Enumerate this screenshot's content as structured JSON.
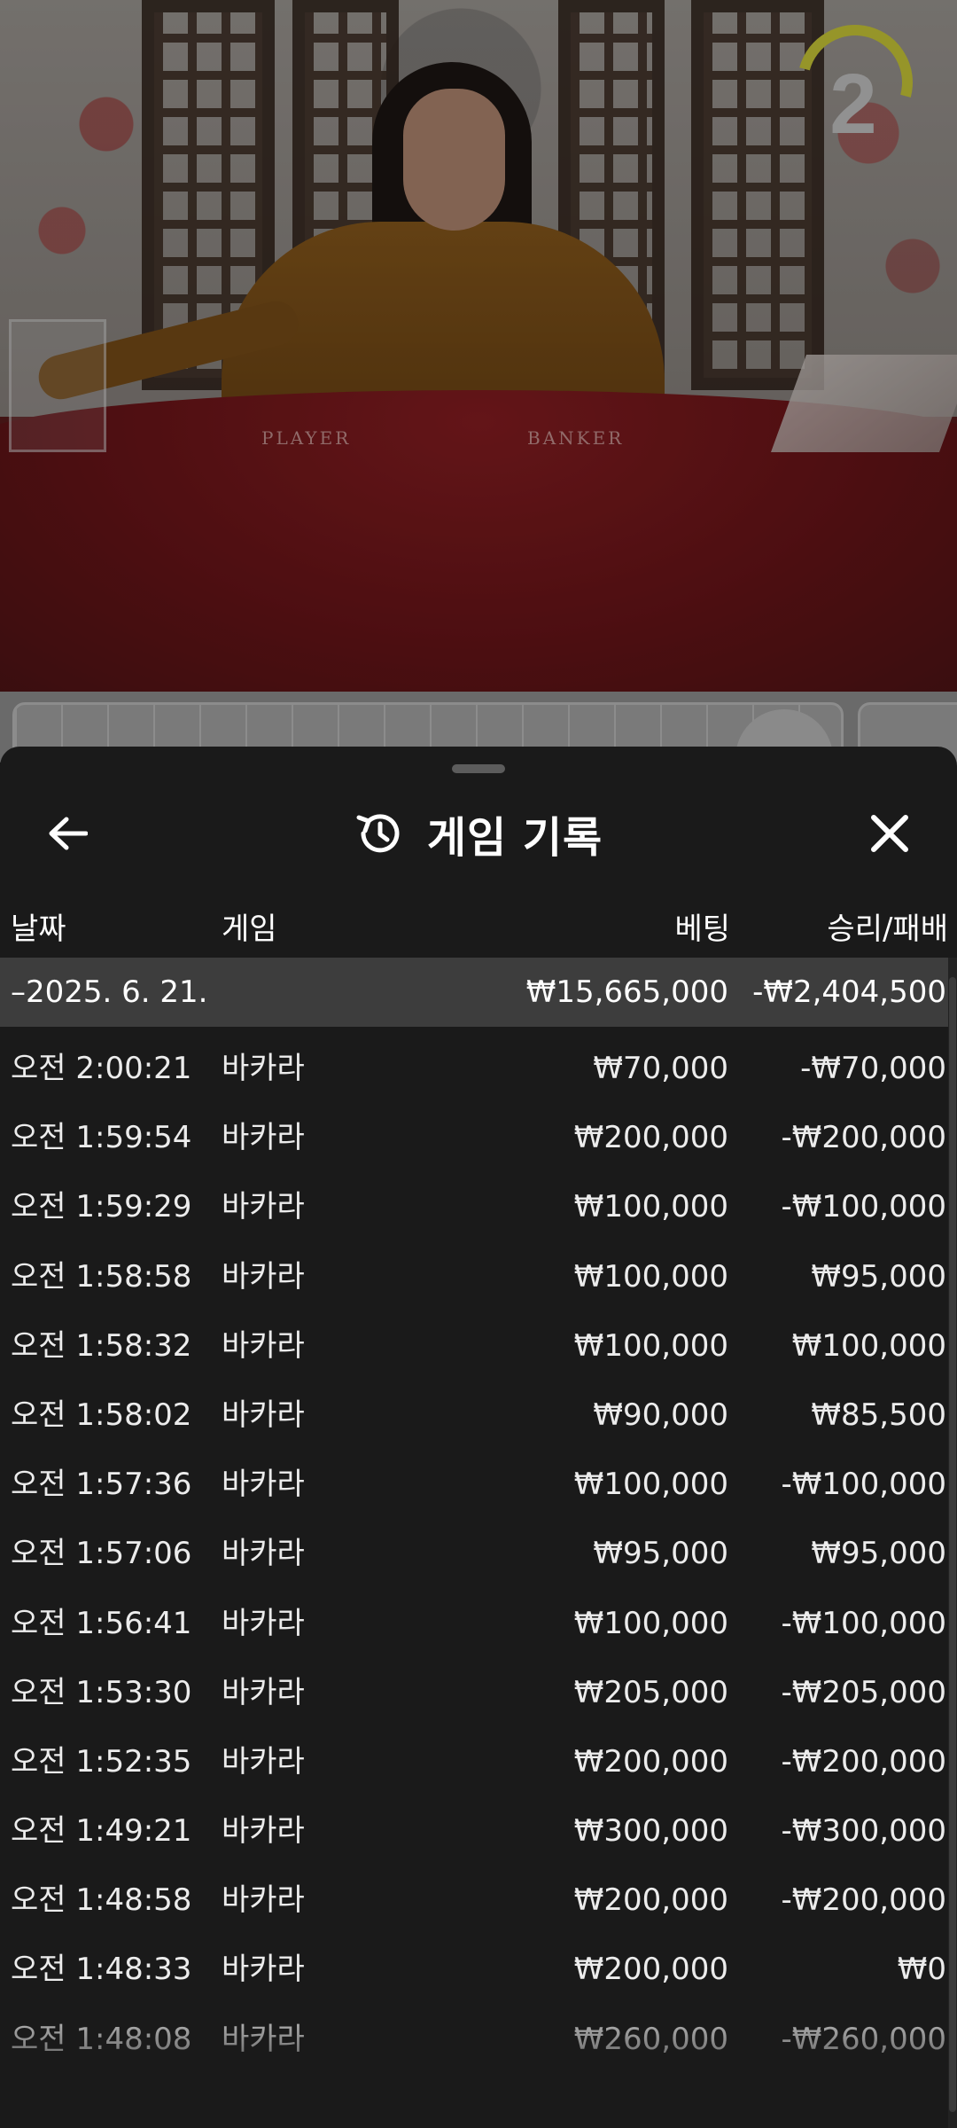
{
  "video": {
    "table_labels": {
      "player": "PLAYER",
      "banker": "BANKER"
    },
    "round_number": "2"
  },
  "sheet": {
    "title": "게임 기록",
    "icons": {
      "back": "arrow-left-icon",
      "history": "history-icon",
      "close": "close-icon"
    },
    "columns": {
      "date": "날짜",
      "game": "게임",
      "bet": "베팅",
      "result": "승리/패배"
    },
    "summary": {
      "date": "–2025. 6. 21.",
      "bet": "₩15,665,000",
      "result": "-₩2,404,500"
    },
    "rows": [
      {
        "time": "오전 2:00:21",
        "game": "바카라",
        "bet": "₩70,000",
        "result": "-₩70,000"
      },
      {
        "time": "오전 1:59:54",
        "game": "바카라",
        "bet": "₩200,000",
        "result": "-₩200,000"
      },
      {
        "time": "오전 1:59:29",
        "game": "바카라",
        "bet": "₩100,000",
        "result": "-₩100,000"
      },
      {
        "time": "오전 1:58:58",
        "game": "바카라",
        "bet": "₩100,000",
        "result": "₩95,000"
      },
      {
        "time": "오전 1:58:32",
        "game": "바카라",
        "bet": "₩100,000",
        "result": "₩100,000"
      },
      {
        "time": "오전 1:58:02",
        "game": "바카라",
        "bet": "₩90,000",
        "result": "₩85,500"
      },
      {
        "time": "오전 1:57:36",
        "game": "바카라",
        "bet": "₩100,000",
        "result": "-₩100,000"
      },
      {
        "time": "오전 1:57:06",
        "game": "바카라",
        "bet": "₩95,000",
        "result": "₩95,000"
      },
      {
        "time": "오전 1:56:41",
        "game": "바카라",
        "bet": "₩100,000",
        "result": "-₩100,000"
      },
      {
        "time": "오전 1:53:30",
        "game": "바카라",
        "bet": "₩205,000",
        "result": "-₩205,000"
      },
      {
        "time": "오전 1:52:35",
        "game": "바카라",
        "bet": "₩200,000",
        "result": "-₩200,000"
      },
      {
        "time": "오전 1:49:21",
        "game": "바카라",
        "bet": "₩300,000",
        "result": "-₩300,000"
      },
      {
        "time": "오전 1:48:58",
        "game": "바카라",
        "bet": "₩200,000",
        "result": "-₩200,000"
      },
      {
        "time": "오전 1:48:33",
        "game": "바카라",
        "bet": "₩200,000",
        "result": "₩0"
      },
      {
        "time": "오전 1:48:08",
        "game": "바카라",
        "bet": "₩260,000",
        "result": "-₩260,000"
      }
    ]
  }
}
